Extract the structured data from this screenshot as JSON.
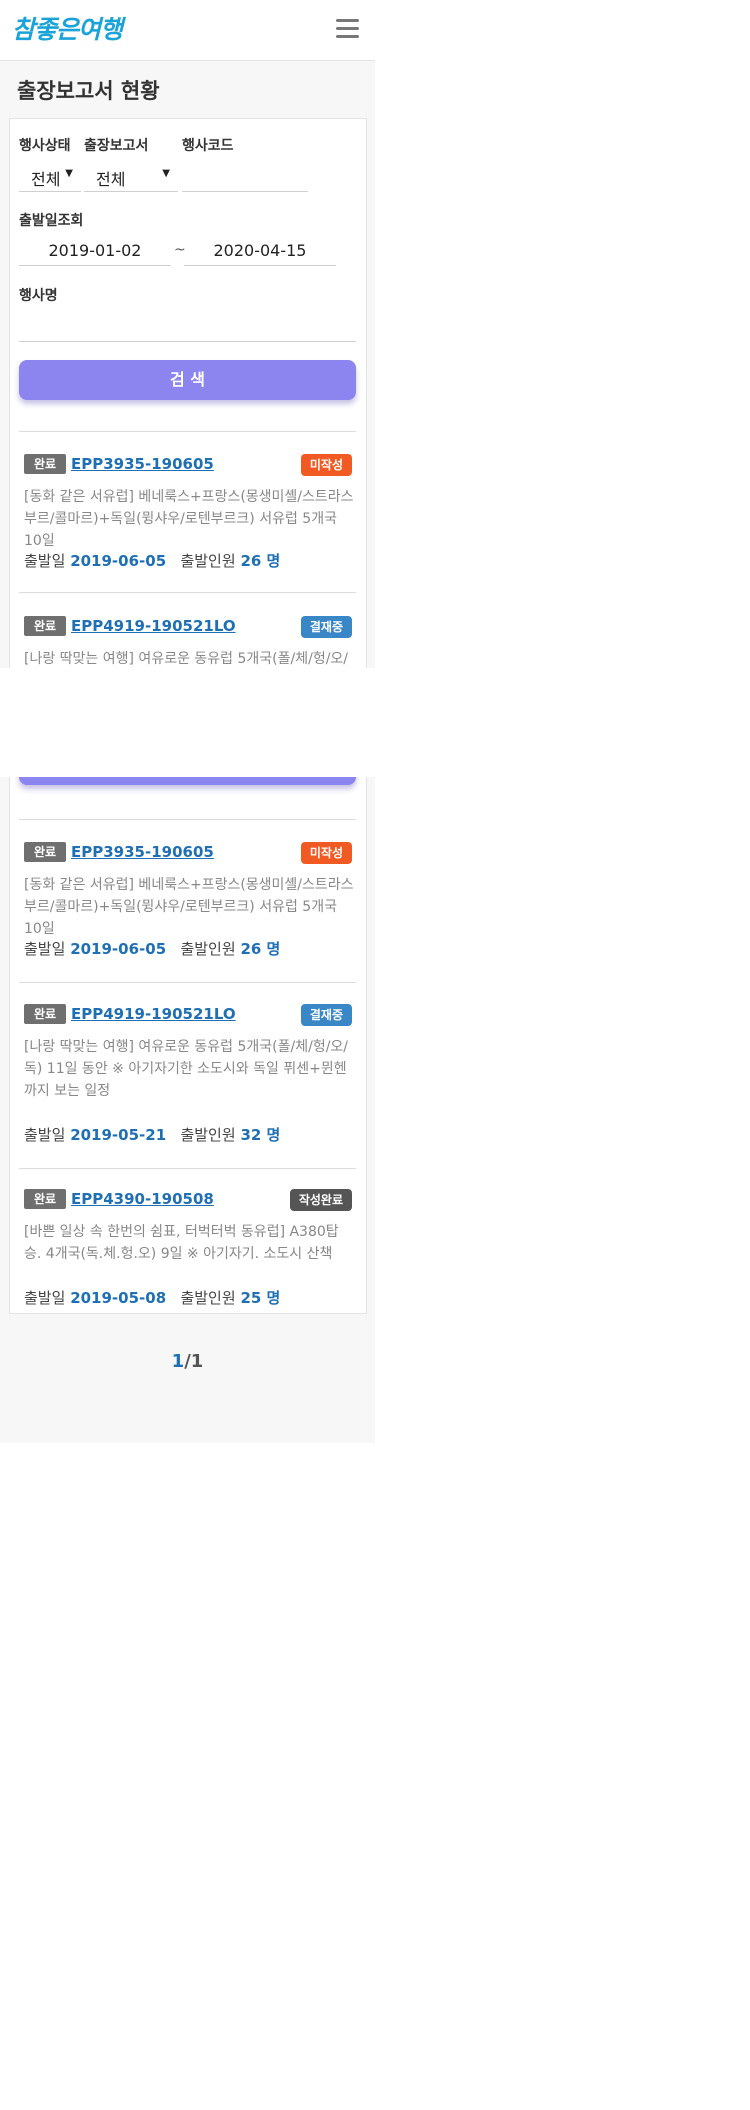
{
  "header": {
    "logo_text": "참좋은여행",
    "menu_icon": "hamburger-menu-icon"
  },
  "page_title": "출장보고서 현황",
  "filters": {
    "status_label": "행사상태",
    "status_value": "전체",
    "report_label": "출장보고서",
    "report_value": "전체",
    "code_label": "행사코드",
    "code_value": "",
    "date_label": "출발일조회",
    "date_from": "2019-01-02",
    "date_sep": "~",
    "date_to": "2020-04-15",
    "name_label": "행사명",
    "name_value": ""
  },
  "search_button": "검 색",
  "items": [
    {
      "status": "완료",
      "code": "EPP3935-190605",
      "badge": "미작성",
      "badge_color": "#f15a22",
      "desc": "[동화 같은 서유럽] 베네룩스+프랑스(몽생미셸/스트라스부르/콜마르)+독일(뮝샤우/로텐부르크) 서유럽 5개국 10일",
      "date_label": "출발일",
      "date": "2019-06-05",
      "pax_label": "출발인원",
      "pax": "26 명"
    },
    {
      "status": "완료",
      "code": "EPP4919-190521LO",
      "badge": "결재중",
      "badge_color": "#3a87c8",
      "desc": "[나랑 딱맞는 여행] 여유로운 동유럽 5개국(폴/체/헝/오/독) 11일 동안 ※ 아기자기한 소도시와 독일 퓌센+뮌헨까지 보는 일정",
      "date_label": "출발일",
      "date": "2019-05-21",
      "pax_label": "출발인원",
      "pax": "32 명"
    },
    {
      "status": "완료",
      "code": "EPP4390-190508",
      "badge": "작성완료",
      "badge_color": "#555555",
      "desc": "[바쁜 일상 속 한번의 쉼표, 터벅터벅 동유럽] A380탑승. 4개국(독.체.헝.오) 9일 ※ 아기자기. 소도시 산책",
      "date_label": "출발일",
      "date": "2019-05-08",
      "pax_label": "출발인원",
      "pax": "25 명"
    }
  ],
  "pager": {
    "current": "1",
    "sep": "/",
    "total": "1"
  }
}
